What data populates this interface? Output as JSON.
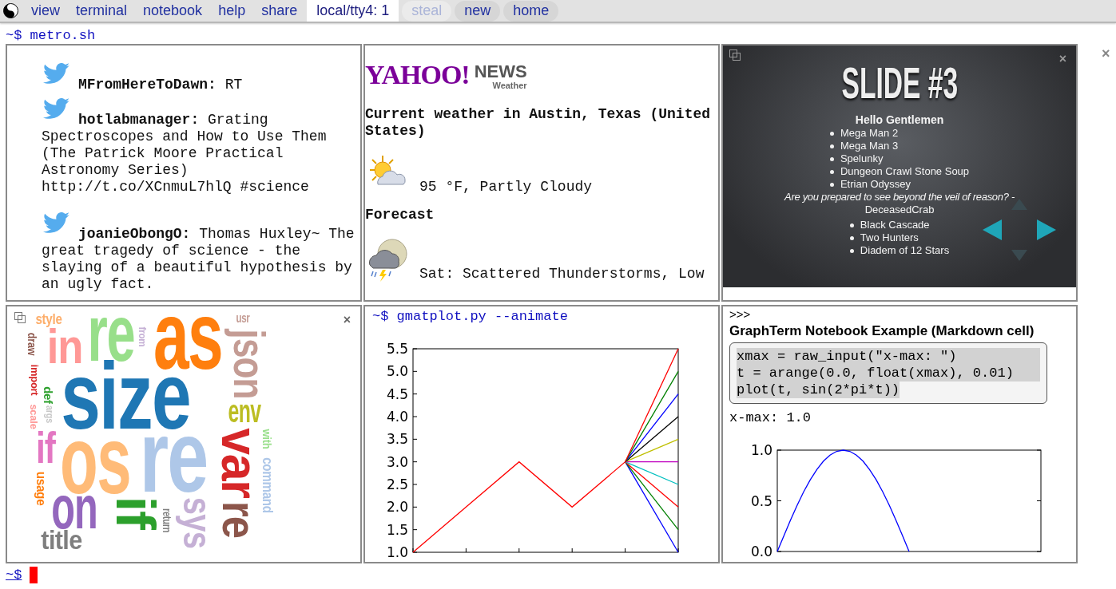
{
  "menu": [
    {
      "label": "view",
      "kind": "link",
      "disabled": false
    },
    {
      "label": "terminal",
      "kind": "link",
      "disabled": false
    },
    {
      "label": "notebook",
      "kind": "link",
      "disabled": false
    },
    {
      "label": "help",
      "kind": "link",
      "disabled": false
    },
    {
      "label": "share",
      "kind": "link",
      "disabled": false
    },
    {
      "label": "local/tty4: 1",
      "kind": "session",
      "disabled": false
    },
    {
      "label": "steal",
      "kind": "pill",
      "disabled": true
    },
    {
      "label": "new",
      "kind": "pill",
      "disabled": false
    },
    {
      "label": "home",
      "kind": "pill",
      "disabled": false
    }
  ],
  "command_line": "~$ metro.sh",
  "page_close": "×",
  "tweets": [
    {
      "user": "MFromHereToDawn:",
      "text": "RT"
    },
    {
      "user": "hotlabmanager:",
      "text": "Grating Spectroscopes and How to Use Them (The Patrick Moore Practical Astronomy Series) http://t.co/XCnmuL7hlQ #science"
    },
    {
      "user": "joanieObongO:",
      "text": "Thomas Huxley~ The great tragedy of science - the slaying of a beautiful hypothesis by an ugly fact."
    }
  ],
  "weather": {
    "logo": {
      "brand": "YAHOO!",
      "section": "NEWS",
      "subsection": "Weather"
    },
    "heading": "Current weather in Austin, Texas (United States)",
    "current": "95 °F, Partly Cloudy",
    "forecast_heading": "Forecast",
    "forecast": "Sat: Scattered Thunderstorms, Low"
  },
  "slide": {
    "close": "×",
    "title": "SLIDE #3",
    "subtitle": "Hello Gentlemen",
    "list_1": [
      "Mega Man 2",
      "Mega Man 3",
      "Spelunky",
      "Dungeon Crawl Stone Soup",
      "Etrian Odyssey"
    ],
    "quote": "Are you prepared to see beyond the veil of reason? -",
    "quote_author": "DeceasedCrab",
    "list_2": [
      "Black Cascade",
      "Two Hunters",
      "Diadem of 12 Stars"
    ]
  },
  "wordcloud": {
    "close": "×",
    "words": [
      {
        "text": "style",
        "color": "#fdae6b",
        "vertical": false
      },
      {
        "text": "in",
        "color": "#ff9896",
        "vertical": false
      },
      {
        "text": "re",
        "color": "#98df8a",
        "vertical": false
      },
      {
        "text": "from",
        "color": "#c5b0d5",
        "vertical": true
      },
      {
        "text": "as",
        "color": "#ff7f0e",
        "vertical": false
      },
      {
        "text": "usr",
        "color": "#c49c94",
        "vertical": false
      },
      {
        "text": "json",
        "color": "#c49c94",
        "vertical": true
      },
      {
        "text": "draw",
        "color": "#8c564b",
        "vertical": true
      },
      {
        "text": "import",
        "color": "#d62728",
        "vertical": true
      },
      {
        "text": "def",
        "color": "#2ca02c",
        "vertical": true
      },
      {
        "text": "args",
        "color": "#c7c7c7",
        "vertical": true
      },
      {
        "text": "scale",
        "color": "#ff9896",
        "vertical": true
      },
      {
        "text": "size",
        "color": "#1f77b4",
        "vertical": false
      },
      {
        "text": "env",
        "color": "#bcbd22",
        "vertical": false
      },
      {
        "text": "with",
        "color": "#98df8a",
        "vertical": true
      },
      {
        "text": "command",
        "color": "#aec7e8",
        "vertical": true
      },
      {
        "text": "if",
        "color": "#e377c2",
        "vertical": false
      },
      {
        "text": "os",
        "color": "#ffbb78",
        "vertical": false
      },
      {
        "text": "re",
        "color": "#aec7e8",
        "vertical": false
      },
      {
        "text": "var",
        "color": "#d62728",
        "vertical": true
      },
      {
        "text": "usage",
        "color": "#ff7f0e",
        "vertical": true
      },
      {
        "text": "on",
        "color": "#9467bd",
        "vertical": false
      },
      {
        "text": "if",
        "color": "#2ca02c",
        "vertical": true
      },
      {
        "text": "return",
        "color": "#7f7f7f",
        "vertical": true
      },
      {
        "text": "sys",
        "color": "#c5b0d5",
        "vertical": true
      },
      {
        "text": "re",
        "color": "#8c564b",
        "vertical": true
      },
      {
        "text": "title",
        "color": "#7f7f7f",
        "vertical": false
      }
    ]
  },
  "plot": {
    "command": "~$ gmatplot.py --animate",
    "chart_data": {
      "type": "line",
      "categories": [
        null,
        null,
        null,
        null,
        null,
        null
      ],
      "ylim": [
        1,
        5.5
      ],
      "yticks": [
        {
          "value": 1,
          "label": "1.0"
        },
        {
          "value": 1.5,
          "label": "1.5"
        },
        {
          "value": 2,
          "label": "2.0"
        },
        {
          "value": 2.5,
          "label": "2.5"
        },
        {
          "value": 3,
          "label": "3.0"
        },
        {
          "value": 3.5,
          "label": "3.5"
        },
        {
          "value": 4,
          "label": "4.0"
        },
        {
          "value": 4.5,
          "label": "4.5"
        },
        {
          "value": 5,
          "label": "5.0"
        },
        {
          "value": 5.5,
          "label": "5.5"
        }
      ],
      "series": [
        {
          "color": "#0000ff",
          "values": [
            null,
            null,
            null,
            null,
            3,
            1
          ]
        },
        {
          "color": "#008000",
          "values": [
            null,
            null,
            null,
            null,
            3,
            1.5
          ]
        },
        {
          "color": "#ff0000",
          "values": [
            null,
            null,
            null,
            null,
            3,
            2
          ]
        },
        {
          "color": "#00bfbf",
          "values": [
            null,
            null,
            null,
            null,
            3,
            2.5
          ]
        },
        {
          "color": "#bf00bf",
          "values": [
            null,
            null,
            null,
            null,
            3,
            3
          ]
        },
        {
          "color": "#bfbf00",
          "values": [
            null,
            null,
            null,
            null,
            3,
            3.5
          ]
        },
        {
          "color": "#000000",
          "values": [
            null,
            null,
            null,
            null,
            3,
            4
          ]
        },
        {
          "color": "#0000ff",
          "values": [
            null,
            null,
            null,
            null,
            3,
            4.5
          ]
        },
        {
          "color": "#008000",
          "values": [
            null,
            null,
            null,
            null,
            3,
            5
          ]
        },
        {
          "color": "#ff0000",
          "values": [
            1,
            2,
            3,
            2,
            3,
            5.5
          ]
        }
      ]
    }
  },
  "notebook": {
    "prompt": ">>>",
    "heading": "GraphTerm Notebook Example (Markdown cell)",
    "code": [
      "xmax = raw_input(\"x-max: \")",
      "t = arange(0.0, float(xmax), 0.01)",
      "plot(t, sin(2*pi*t))"
    ],
    "output": "x-max: 1.0",
    "chart_data": {
      "type": "line",
      "categories": [
        null,
        null,
        null,
        null,
        null,
        null,
        null,
        null,
        null,
        null,
        null,
        null,
        null,
        null,
        null,
        null,
        null,
        null,
        null,
        null,
        null,
        null,
        null,
        null,
        null,
        null,
        null,
        null,
        null,
        null,
        null,
        null,
        null,
        null,
        null,
        null,
        null,
        null,
        null,
        null,
        null
      ],
      "ylim": [
        0,
        1
      ],
      "yticks": [
        {
          "value": 0,
          "label": "0.0"
        },
        {
          "value": 0.5,
          "label": "0.5"
        },
        {
          "value": 1,
          "label": "1.0"
        }
      ],
      "series": [
        {
          "color": "#0000ff",
          "values": [
            0,
            0.156,
            0.309,
            0.454,
            0.588,
            0.707,
            0.809,
            0.891,
            0.951,
            0.988,
            1,
            0.988,
            0.951,
            0.891,
            0.809,
            0.707,
            0.588,
            0.454,
            0.309,
            0.156,
            0,
            null,
            null,
            null,
            null,
            null,
            null,
            null,
            null,
            null,
            null,
            null,
            null,
            null,
            null,
            null,
            null,
            null,
            null,
            null,
            null
          ]
        }
      ]
    }
  },
  "bottom_prompt": "~$"
}
